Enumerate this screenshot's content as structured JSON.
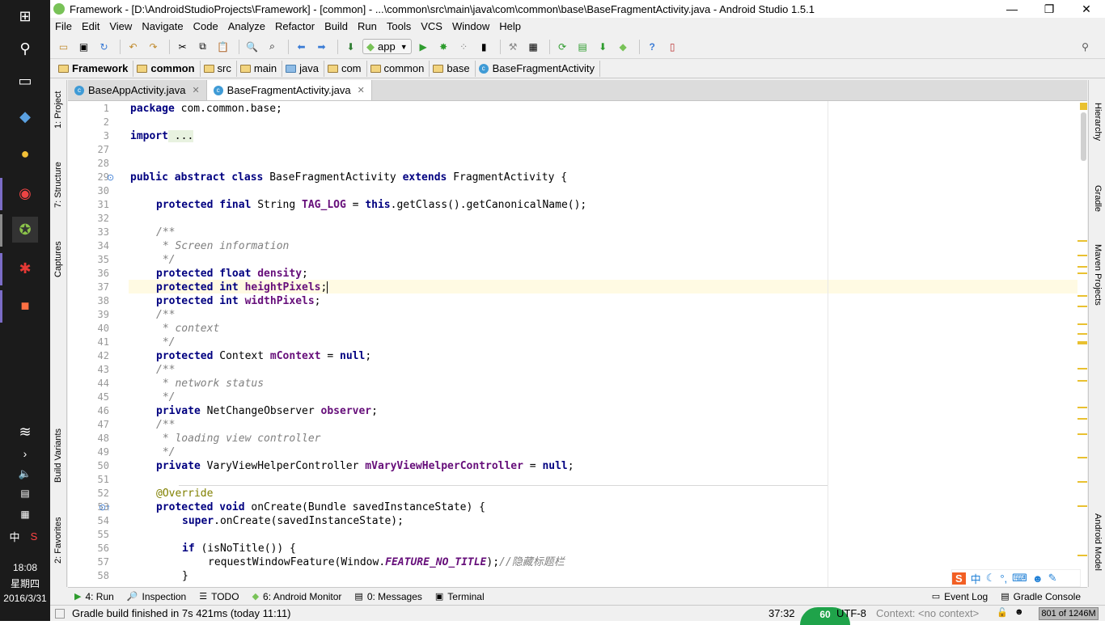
{
  "title": "Framework - [D:\\AndroidStudioProjects\\Framework] - [common] - ...\\common\\src\\main\\java\\com\\common\\base\\BaseFragmentActivity.java - Android Studio 1.5.1",
  "menu": [
    "File",
    "Edit",
    "View",
    "Navigate",
    "Code",
    "Analyze",
    "Refactor",
    "Build",
    "Run",
    "Tools",
    "VCS",
    "Window",
    "Help"
  ],
  "toolbar": {
    "run_config": "app"
  },
  "breadcrumbs": [
    "Framework",
    "common",
    "src",
    "main",
    "java",
    "com",
    "common",
    "base",
    "BaseFragmentActivity"
  ],
  "tabs": [
    {
      "label": "BaseAppActivity.java",
      "active": false
    },
    {
      "label": "BaseFragmentActivity.java",
      "active": true
    }
  ],
  "left_tools": [
    "1: Project",
    "7: Structure",
    "Captures",
    "Build Variants",
    "2: Favorites"
  ],
  "right_tools": [
    "Hierarchy",
    "Gradle",
    "Maven Projects",
    "Android Model"
  ],
  "line_numbers": [
    "1",
    "2",
    "3",
    "27",
    "28",
    "29",
    "30",
    "31",
    "32",
    "33",
    "34",
    "35",
    "36",
    "37",
    "38",
    "39",
    "40",
    "41",
    "42",
    "43",
    "44",
    "45",
    "46",
    "47",
    "48",
    "49",
    "50",
    "51",
    "52",
    "53",
    "54",
    "55",
    "56",
    "57",
    "58"
  ],
  "code": {
    "l1": [
      "package",
      " com.common.base;"
    ],
    "l3": [
      "import",
      " ..."
    ],
    "l29": [
      "public abstract class",
      " BaseFragmentActivity ",
      "extends",
      " FragmentActivity {"
    ],
    "l31": [
      "protected final",
      " String ",
      "TAG_LOG",
      " = ",
      "this",
      ".getClass().getCanonicalName();"
    ],
    "l33": "/**",
    "l34": " * Screen information",
    "l35": " */",
    "l36": [
      "protected float ",
      "density",
      ";"
    ],
    "l37": [
      "protected int ",
      "heightPixels",
      ";"
    ],
    "l38": [
      "protected int ",
      "widthPixels",
      ";"
    ],
    "l39": "/**",
    "l40": " * context",
    "l41": " */",
    "l42": [
      "protected",
      " Context ",
      "mContext",
      " = ",
      "null",
      ";"
    ],
    "l43": "/**",
    "l44": " * network status",
    "l45": " */",
    "l46": [
      "private",
      " NetChangeObserver ",
      "observer",
      ";"
    ],
    "l47": "/**",
    "l48": " * loading view controller",
    "l49": " */",
    "l50": [
      "private",
      " VaryViewHelperController ",
      "mVaryViewHelperController",
      " = ",
      "null",
      ";"
    ],
    "l52": "@Override",
    "l53": [
      "protected void",
      " onCreate(Bundle savedInstanceState) {"
    ],
    "l54": [
      "super",
      ".onCreate(savedInstanceState);"
    ],
    "l56": [
      "if",
      " (isNoTitle()) {"
    ],
    "l57": [
      "requestWindowFeature(Window.",
      "FEATURE_NO_TITLE",
      ");",
      "//隐藏标题栏"
    ],
    "l58": "}"
  },
  "bottom_tools": [
    "4: Run",
    "Inspection",
    "TODO",
    "6: Android Monitor",
    "0: Messages",
    "Terminal",
    "Event Log",
    "Gradle Console"
  ],
  "status": {
    "message": "Gradle build finished in 7s 421ms (today 11:11)",
    "position": "37:32",
    "encoding": "UTF-8",
    "context": "Context: <no context>",
    "memory": "801 of 1246M",
    "badge": "60"
  },
  "taskbar": {
    "time": "18:08",
    "weekday": "星期四",
    "date": "2016/3/31",
    "ime": "中"
  }
}
